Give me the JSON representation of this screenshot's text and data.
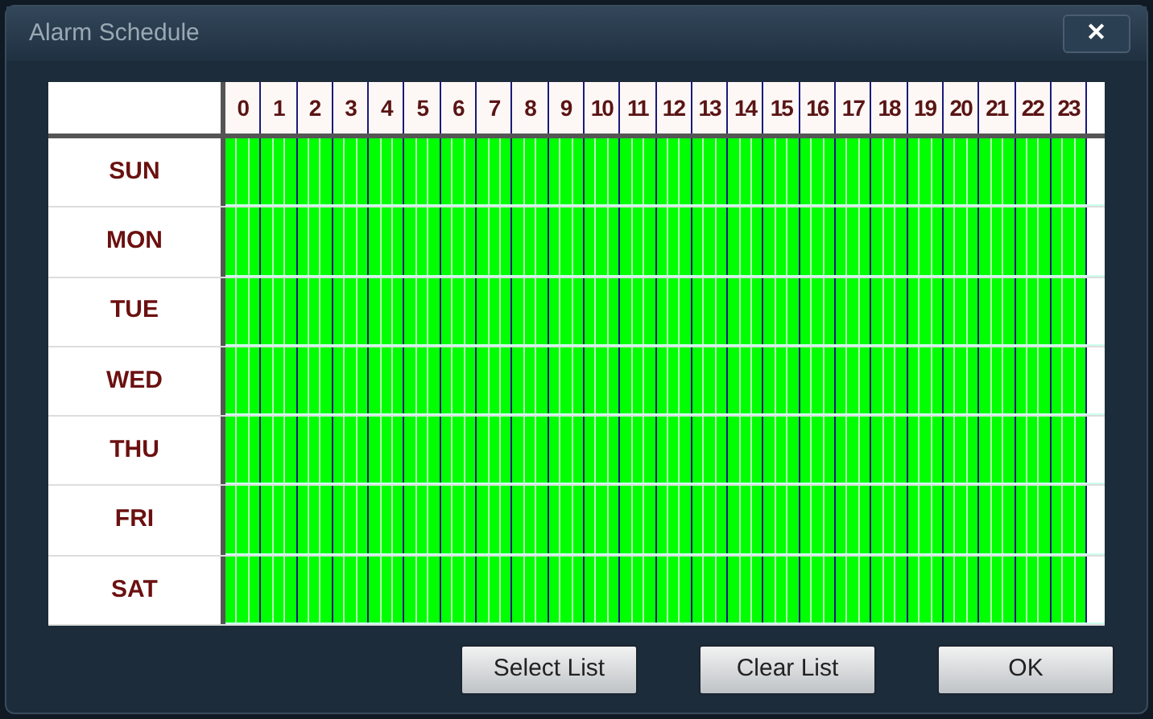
{
  "window": {
    "title": "Alarm Schedule",
    "close": "✕"
  },
  "hours": [
    "0",
    "1",
    "2",
    "3",
    "4",
    "5",
    "6",
    "7",
    "8",
    "9",
    "10",
    "11",
    "12",
    "13",
    "14",
    "15",
    "16",
    "17",
    "18",
    "19",
    "20",
    "21",
    "22",
    "23"
  ],
  "days": [
    {
      "label": "SUN",
      "hours_selected": [
        true,
        true,
        true,
        true,
        true,
        true,
        true,
        true,
        true,
        true,
        true,
        true,
        true,
        true,
        true,
        true,
        true,
        true,
        true,
        true,
        true,
        true,
        true,
        true
      ]
    },
    {
      "label": "MON",
      "hours_selected": [
        true,
        true,
        true,
        true,
        true,
        true,
        true,
        true,
        true,
        true,
        true,
        true,
        true,
        true,
        true,
        true,
        true,
        true,
        true,
        true,
        true,
        true,
        true,
        true
      ]
    },
    {
      "label": "TUE",
      "hours_selected": [
        true,
        true,
        true,
        true,
        true,
        true,
        true,
        true,
        true,
        true,
        true,
        true,
        true,
        true,
        true,
        true,
        true,
        true,
        true,
        true,
        true,
        true,
        true,
        true
      ]
    },
    {
      "label": "WED",
      "hours_selected": [
        true,
        true,
        true,
        true,
        true,
        true,
        true,
        true,
        true,
        true,
        true,
        true,
        true,
        true,
        true,
        true,
        true,
        true,
        true,
        true,
        true,
        true,
        true,
        true
      ]
    },
    {
      "label": "THU",
      "hours_selected": [
        true,
        true,
        true,
        true,
        true,
        true,
        true,
        true,
        true,
        true,
        true,
        true,
        true,
        true,
        true,
        true,
        true,
        true,
        true,
        true,
        true,
        true,
        true,
        true
      ]
    },
    {
      "label": "FRI",
      "hours_selected": [
        true,
        true,
        true,
        true,
        true,
        true,
        true,
        true,
        true,
        true,
        true,
        true,
        true,
        true,
        true,
        true,
        true,
        true,
        true,
        true,
        true,
        true,
        true,
        true
      ]
    },
    {
      "label": "SAT",
      "hours_selected": [
        true,
        true,
        true,
        true,
        true,
        true,
        true,
        true,
        true,
        true,
        true,
        true,
        true,
        true,
        true,
        true,
        true,
        true,
        true,
        true,
        true,
        true,
        true,
        true
      ]
    }
  ],
  "buttons": [
    "Select List",
    "Clear List",
    "OK"
  ]
}
